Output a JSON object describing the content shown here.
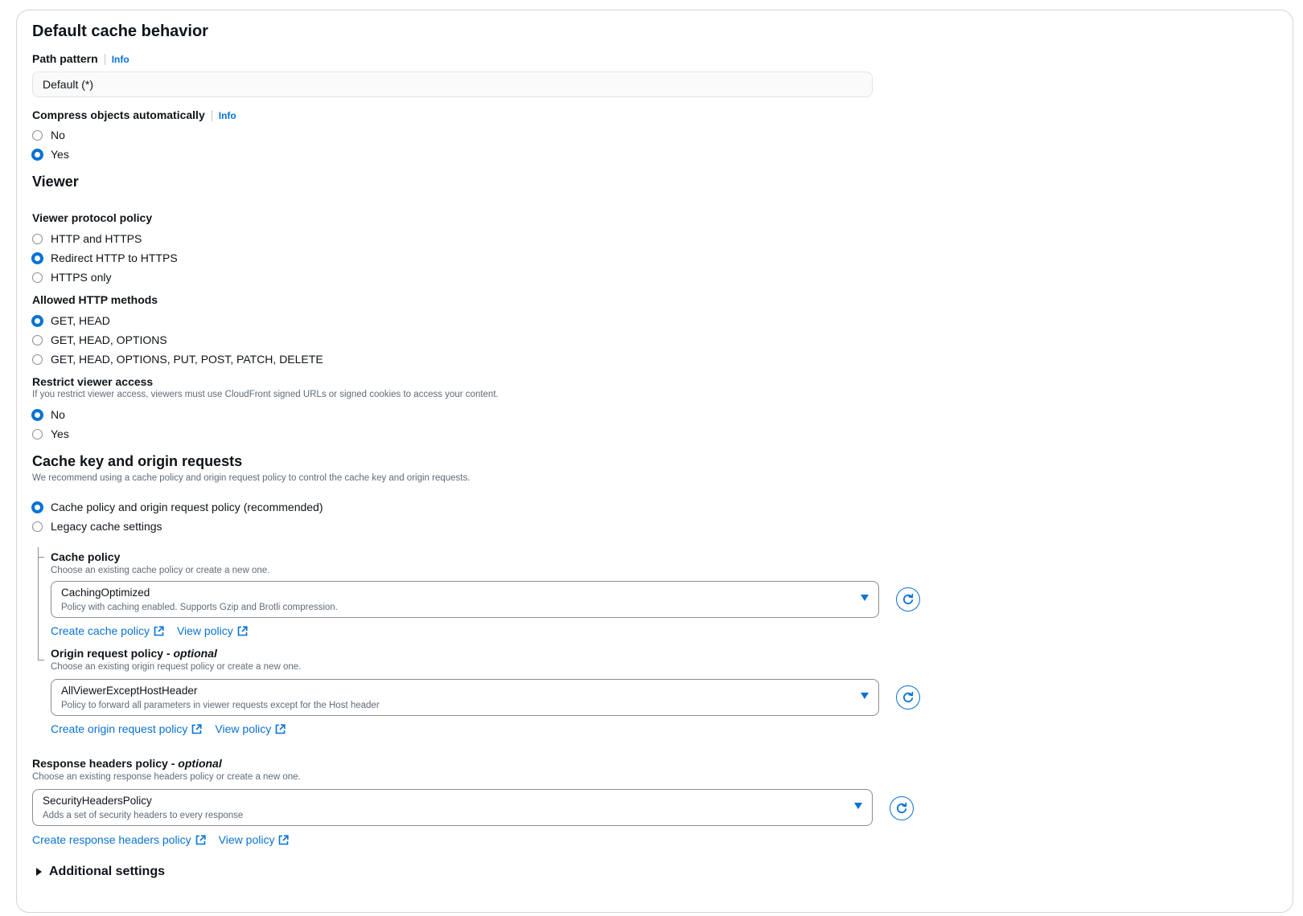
{
  "section": {
    "title": "Default cache behavior"
  },
  "path_pattern": {
    "label": "Path pattern",
    "info": "Info",
    "value": "Default (*)"
  },
  "compress": {
    "label": "Compress objects automatically",
    "info": "Info",
    "options": [
      {
        "label": "No",
        "checked": false
      },
      {
        "label": "Yes",
        "checked": true
      }
    ]
  },
  "viewer": {
    "title": "Viewer",
    "protocol": {
      "label": "Viewer protocol policy",
      "options": [
        {
          "label": "HTTP and HTTPS",
          "checked": false
        },
        {
          "label": "Redirect HTTP to HTTPS",
          "checked": true
        },
        {
          "label": "HTTPS only",
          "checked": false
        }
      ]
    },
    "methods": {
      "label": "Allowed HTTP methods",
      "options": [
        {
          "label": "GET, HEAD",
          "checked": true
        },
        {
          "label": "GET, HEAD, OPTIONS",
          "checked": false
        },
        {
          "label": "GET, HEAD, OPTIONS, PUT, POST, PATCH, DELETE",
          "checked": false
        }
      ]
    },
    "restrict": {
      "label": "Restrict viewer access",
      "description": "If you restrict viewer access, viewers must use CloudFront signed URLs or signed cookies to access your content.",
      "options": [
        {
          "label": "No",
          "checked": true
        },
        {
          "label": "Yes",
          "checked": false
        }
      ]
    }
  },
  "cache_key": {
    "title": "Cache key and origin requests",
    "description": "We recommend using a cache policy and origin request policy to control the cache key and origin requests.",
    "options": [
      {
        "label": "Cache policy and origin request policy (recommended)",
        "checked": true
      },
      {
        "label": "Legacy cache settings",
        "checked": false
      }
    ],
    "cache_policy": {
      "label": "Cache policy",
      "description": "Choose an existing cache policy or create a new one.",
      "selected_title": "CachingOptimized",
      "selected_desc": "Policy with caching enabled. Supports Gzip and Brotli compression.",
      "create_link": "Create cache policy",
      "view_link": "View policy"
    },
    "origin_policy": {
      "label_main": "Origin request policy - ",
      "label_optional": "optional",
      "description": "Choose an existing origin request policy or create a new one.",
      "selected_title": "AllViewerExceptHostHeader",
      "selected_desc": "Policy to forward all parameters in viewer requests except for the Host header",
      "create_link": "Create origin request policy",
      "view_link": "View policy"
    }
  },
  "response_headers": {
    "label_main": "Response headers policy - ",
    "label_optional": "optional",
    "description": "Choose an existing response headers policy or create a new one.",
    "selected_title": "SecurityHeadersPolicy",
    "selected_desc": "Adds a set of security headers to every response",
    "create_link": "Create response headers policy",
    "view_link": "View policy"
  },
  "additional": {
    "label": "Additional settings"
  },
  "colors": {
    "accent": "#0972d3",
    "text": "#0f141a",
    "muted": "#5f6b7a",
    "border": "#8c8c94"
  },
  "icons": {
    "refresh": "refresh-icon",
    "external": "external-link-icon",
    "dropdown": "caret-down-icon",
    "expand": "caret-right-icon"
  }
}
